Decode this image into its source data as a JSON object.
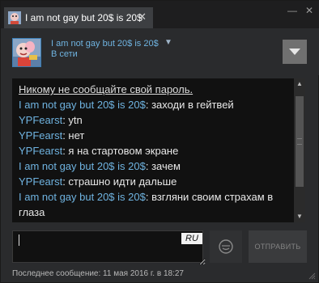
{
  "tab": {
    "title": "I am not gay but 20$ is 20$",
    "close": "✕"
  },
  "window_controls": {
    "minimize": "—",
    "close": "✕"
  },
  "header": {
    "friend_name": "I am not gay but 20$ is 20$",
    "name_chevron": "▼",
    "status": "В сети",
    "menu_icon": "chevron-down-icon"
  },
  "messages": [
    {
      "kind": "warning",
      "text": "Никому не сообщайте свой пароль."
    },
    {
      "kind": "chat",
      "sender": "I am not gay but 20$ is 20$",
      "sender_class": "a",
      "text": "заходи в гейтвей"
    },
    {
      "kind": "chat",
      "sender": "YPFearst",
      "sender_class": "b",
      "text": "ytn"
    },
    {
      "kind": "chat",
      "sender": "YPFearst",
      "sender_class": "b",
      "text": "нет"
    },
    {
      "kind": "chat",
      "sender": "YPFearst",
      "sender_class": "b",
      "text": "я на стартовом экране"
    },
    {
      "kind": "chat",
      "sender": "I am not gay but 20$ is 20$",
      "sender_class": "a",
      "text": "зачем"
    },
    {
      "kind": "chat",
      "sender": "YPFearst",
      "sender_class": "b",
      "text": "страшно идти дальше"
    },
    {
      "kind": "chat",
      "sender": "I am not gay but 20$ is 20$",
      "sender_class": "a",
      "text": "взгляни своим страхам в глаза"
    },
    {
      "kind": "chat",
      "sender": "I am not gay but 20$ is 20$",
      "sender_class": "a",
      "text": ""
    }
  ],
  "scrollbar": {
    "up": "▲",
    "down": "▼"
  },
  "composer": {
    "value": "",
    "lang_badge": "RU",
    "emoji_icon": "smiley-icon",
    "send_label": "ОТПРАВИТЬ"
  },
  "footer": {
    "last_message": "Последнее сообщение: 11 мая 2016 г. в 18:27"
  },
  "colors": {
    "accent_link": "#6fb3e0",
    "background": "#2a2b2d",
    "message_area": "#111111"
  }
}
